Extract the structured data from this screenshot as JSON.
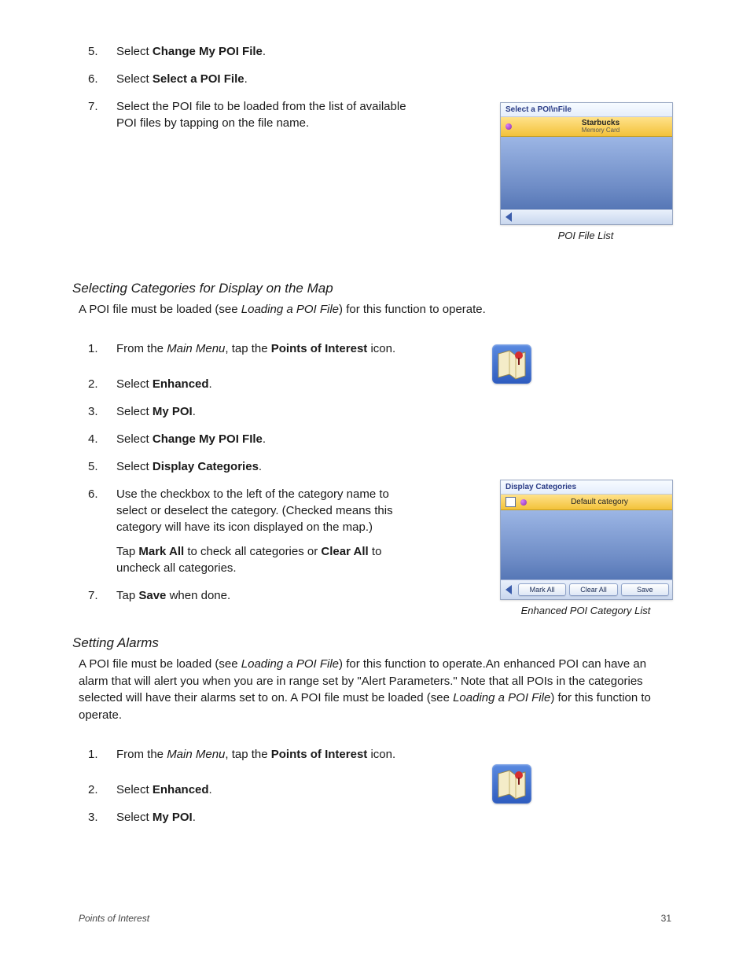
{
  "top_steps": [
    {
      "num": "5.",
      "text_pre": "Select ",
      "bold": "Change My POI File",
      "text_post": "."
    },
    {
      "num": "6.",
      "text_pre": "Select ",
      "bold": "Select a POI File",
      "text_post": "."
    },
    {
      "num": "7.",
      "text_full": "Select the POI file to be loaded from the list of available POI files by tapping on the file name."
    }
  ],
  "fig1": {
    "title": "Select a POI\\nFile",
    "row_main": "Starbucks",
    "row_sub": "Memory Card",
    "caption": "POI File List"
  },
  "section1": {
    "heading": "Selecting Categories for Display on the Map",
    "intro_pre": "A POI file must be loaded (see ",
    "intro_ital": "Loading a POI File",
    "intro_post": ") for this function to operate."
  },
  "steps1": {
    "s1_pre": "From the ",
    "s1_ital": "Main Menu",
    "s1_mid": ", tap the ",
    "s1_bold": "Points of Interest",
    "s1_post": " icon.",
    "s2_pre": "Select ",
    "s2_bold": "Enhanced",
    "s2_post": ".",
    "s3_pre": "Select ",
    "s3_bold": "My POI",
    "s3_post": ".",
    "s4_pre": "Select ",
    "s4_bold": "Change My POI FIle",
    "s4_post": ".",
    "s5_pre": "Select ",
    "s5_bold": "Display Categories",
    "s5_post": ".",
    "s6": "Use the checkbox to the left of the category name to select or deselect the category. (Checked means this category will have its icon displayed on the map.)",
    "s6b_pre": "Tap ",
    "s6b_b1": "Mark All",
    "s6b_mid": " to check all categories or ",
    "s6b_b2": "Clear All",
    "s6b_post": " to uncheck all categories.",
    "s7_pre": "Tap ",
    "s7_bold": "Save",
    "s7_post": " when done."
  },
  "fig2": {
    "title": "Display Categories",
    "row_label": "Default category",
    "btn_mark": "Mark All",
    "btn_clear": "Clear All",
    "btn_save": "Save",
    "caption": "Enhanced POI Category List"
  },
  "section2": {
    "heading": "Setting Alarms",
    "intro_a": "A POI file must be loaded (see ",
    "intro_b": "Loading a POI File",
    "intro_c": ") for this function to operate.An enhanced POI can have an alarm that will alert you when you are in range set by \"Alert Parameters.\"  Note that all POIs in the categories selected will have their alarms set to on.  A POI file must be loaded (see ",
    "intro_d": "Loading a POI File",
    "intro_e": ") for this function to operate."
  },
  "steps2": {
    "s1_pre": "From the ",
    "s1_ital": "Main Menu",
    "s1_mid": ", tap the ",
    "s1_bold": "Points of Interest",
    "s1_post": " icon.",
    "s2_pre": "Select ",
    "s2_bold": "Enhanced",
    "s2_post": ".",
    "s3_pre": "Select ",
    "s3_bold": "My POI",
    "s3_post": "."
  },
  "footer": {
    "section": "Points of Interest",
    "page": "31"
  }
}
